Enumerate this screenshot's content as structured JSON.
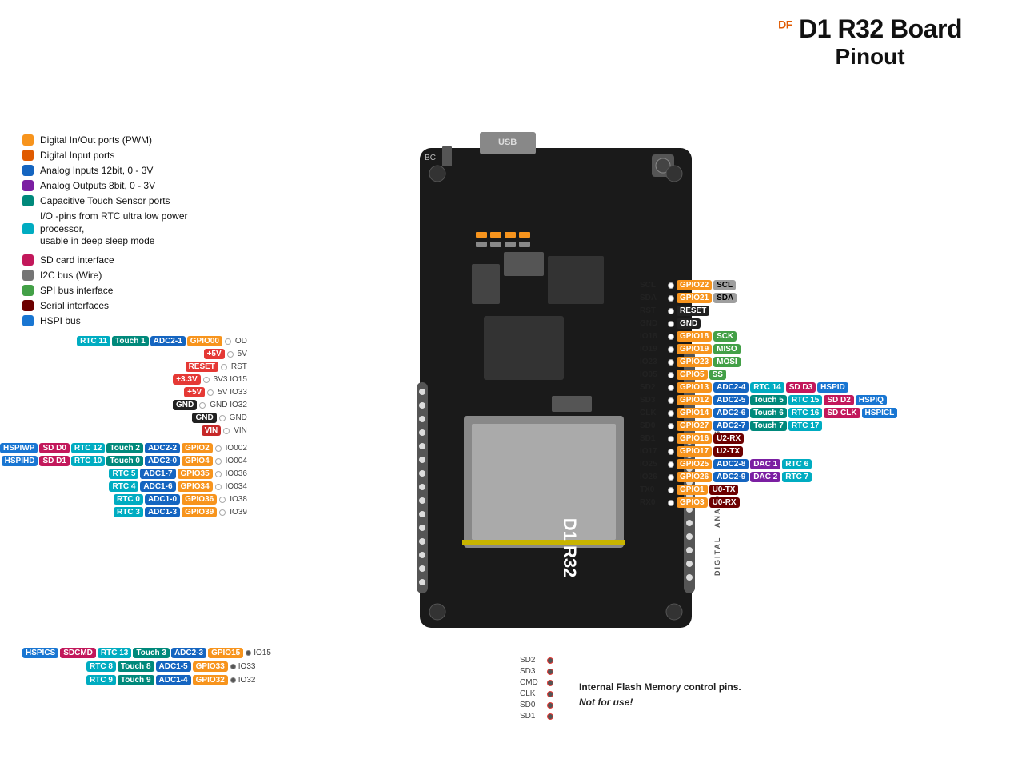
{
  "title": {
    "brand": "DF",
    "main": "D1 R32 Board",
    "sub": "Pinout"
  },
  "legend": [
    {
      "color": "#f7941d",
      "label": "Digital In/Out ports (PWM)"
    },
    {
      "color": "#e05a00",
      "label": "Digital Input ports"
    },
    {
      "color": "#1565c0",
      "label": "Analog Inputs 12bit, 0 - 3V"
    },
    {
      "color": "#7b1fa2",
      "label": "Analog Outputs 8bit, 0 - 3V"
    },
    {
      "color": "#00897b",
      "label": "Capacitive Touch Sensor ports"
    },
    {
      "color": "#00acc1",
      "label": "I/O -pins from RTC ultra low power processor, usable in deep sleep mode"
    },
    {
      "color": "#c2185b",
      "label": "SD card interface"
    },
    {
      "color": "#757575",
      "label": "I2C bus (Wire)"
    },
    {
      "color": "#43a047",
      "label": "SPI bus interface"
    },
    {
      "color": "#6d0000",
      "label": "Serial interfaces"
    },
    {
      "color": "#1976d2",
      "label": "HSPI bus"
    }
  ]
}
